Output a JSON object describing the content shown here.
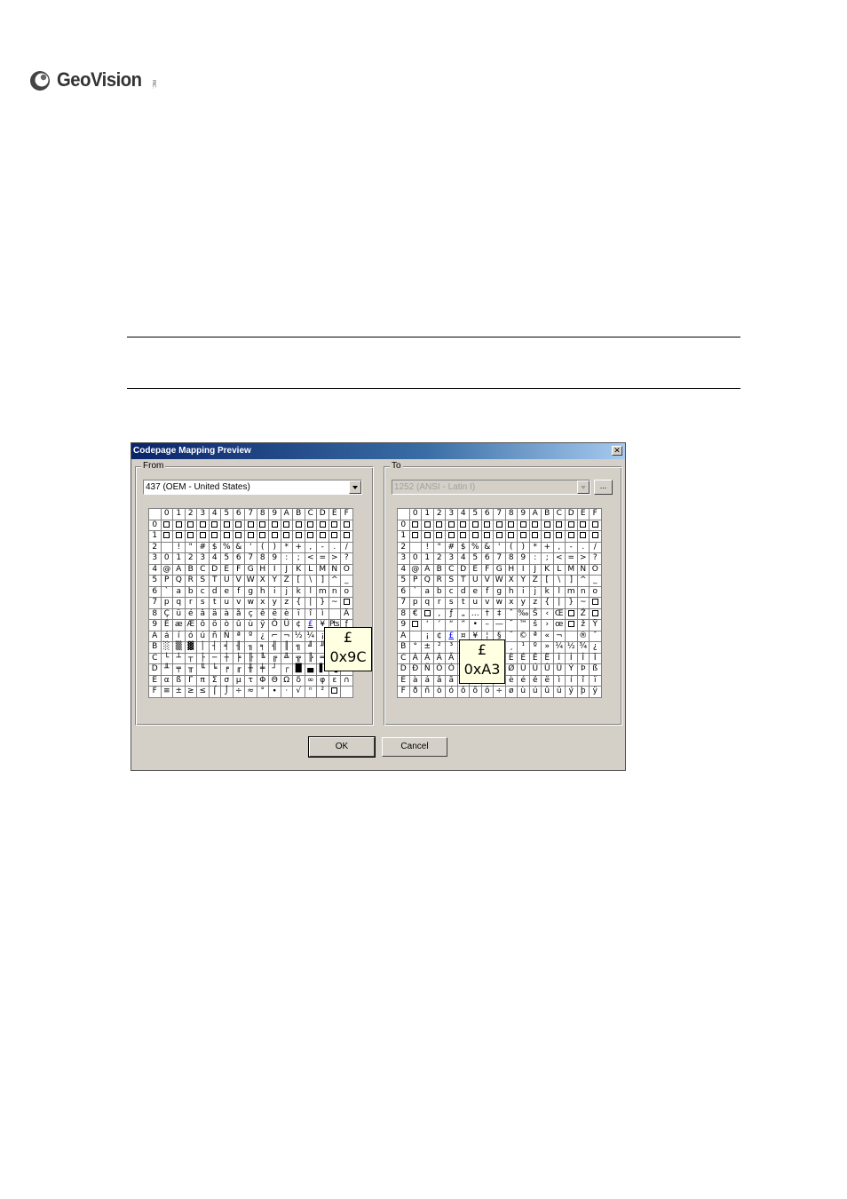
{
  "brand": {
    "name": "GeoVision",
    "tm": "INC."
  },
  "dialog": {
    "title": "Codepage Mapping Preview",
    "close_glyph": "✕",
    "from_label": "From",
    "to_label": "To",
    "from_select": "437   (OEM - United States)",
    "to_select": "1252  (ANSI - Latin I)",
    "browse_label": "...",
    "ok_label": "OK",
    "cancel_label": "Cancel",
    "headers": [
      "0",
      "1",
      "2",
      "3",
      "4",
      "5",
      "6",
      "7",
      "8",
      "9",
      "A",
      "B",
      "C",
      "D",
      "E",
      "F"
    ],
    "from_rows": [
      "■■■■■■■■■■■■■■■■",
      "■■■■■■■■■■■■■■■■",
      " !\"#$%&'()*+,-./",
      "0123456789:;<=>?",
      "@ABCDEFGHIJKLMNO",
      "PQRSTUVWXYZ[\\]^_",
      "`abcdefghijklmno",
      "pqrstuvwxyz{|}~■",
      "Çüéâäàåçêëèïîì ÄÅ",
      "ÉæÆôöòûùÿÖÜ¢£¥₧ƒ",
      "áíóúñÑªº¿⌐¬½¼¡«»",
      "░▒▓│┤╡╢╖╕╣║╗╝╜╛┐",
      "└┴┬├─┼╞╟╚╔╩╦╠═╬╧",
      "╨╤╥╙╘╒╓╫╪┘┌█▄▌▐▀",
      "αßΓπΣσµτΦΘΩδ∞φε∩",
      "≡±≥≤⌠⌡÷≈°∙·√ⁿ²■ "
    ],
    "to_rows": [
      "■■■■■■■■■■■■■■■■",
      "■■■■■■■■■■■■■■■■",
      " !\"#$%&'()*+,-./",
      "0123456789:;<=>?",
      "@ABCDEFGHIJKLMNO",
      "PQRSTUVWXYZ[\\]^_",
      "`abcdefghijklmno",
      "pqrstuvwxyz{|}~■",
      "€■‚ƒ„…†‡ˆ‰Š‹Œ■Ž■",
      "■‘’“”•–—˜™š›œ■žŸ",
      " ¡¢£¤¥¦§¨©ª«¬­®¯",
      "°±²³´µ¶·¸¹º»¼½¾¿",
      "ÀÁÂÃÄÅÆÇÈÉÊËÌÍÎÏ",
      "ÐÑÒÓÔÕÖ×ØÙÚÛÜÝÞß",
      "àáâãäåæçèéêëìíîï",
      "ðñòóôõö÷øùúûüýþÿ"
    ],
    "from_tip": {
      "char": "£",
      "code": "0x9C"
    },
    "to_tip": {
      "char": "£",
      "code": "0xA3"
    }
  }
}
